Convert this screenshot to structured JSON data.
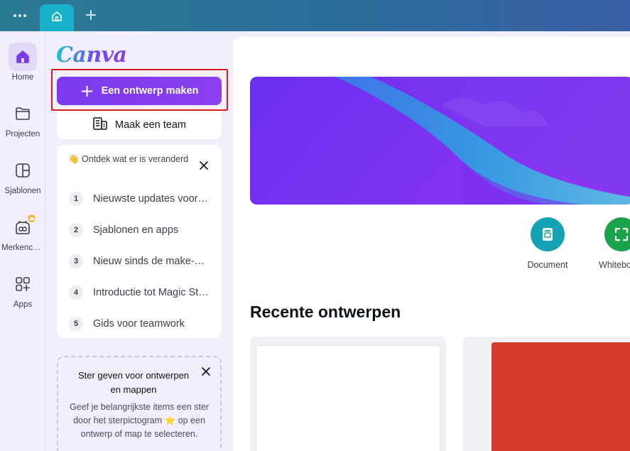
{
  "titlebar": {
    "menu_icon": "more-horizontal-icon",
    "home_tab_icon": "home-icon",
    "new_tab_icon": "plus-icon",
    "new_tab_symbol": "+"
  },
  "rail": {
    "items": [
      {
        "label": "Home",
        "icon": "home-icon",
        "active": true
      },
      {
        "label": "Projecten",
        "icon": "folder-icon"
      },
      {
        "label": "Sjablonen",
        "icon": "templates-icon"
      },
      {
        "label": "Merkencentrum",
        "icon": "brand-icon",
        "badge": "crown-icon"
      },
      {
        "label": "Apps",
        "icon": "apps-icon"
      }
    ]
  },
  "panel": {
    "logo": "Canva",
    "create_button": "Een ontwerp maken",
    "team_button": "Maak een team",
    "discover": {
      "title": "👋 Ontdek wat er is veranderd",
      "items": [
        {
          "num": "1",
          "label": "Nieuwste updates voor Canva"
        },
        {
          "num": "2",
          "label": "Sjablonen en apps"
        },
        {
          "num": "3",
          "label": "Nieuw sinds de make-over"
        },
        {
          "num": "4",
          "label": "Introductie tot Magic Studio"
        },
        {
          "num": "5",
          "label": "Gids voor teamwork"
        }
      ]
    },
    "starred": {
      "title": "Ster geven voor ontwerpen en mappen",
      "body": "Geef je belangrijkste items een ster door het sterpictogram ⭐ op een ontwerp of map te selecteren."
    }
  },
  "main": {
    "quick_actions": [
      {
        "label": "Document",
        "icon": "document-icon",
        "color": "#13a3b5"
      },
      {
        "label": "Whiteboard",
        "icon": "whiteboard-icon",
        "color": "#1aa34a"
      }
    ],
    "recent_title": "Recente ontwerpen"
  },
  "colors": {
    "accent": "#7c3aed",
    "highlight_outline": "#d91c1c",
    "titlebar": "#2a6f99",
    "tab": "#17b1cc",
    "thumbnail_red": "#d63a2a"
  }
}
